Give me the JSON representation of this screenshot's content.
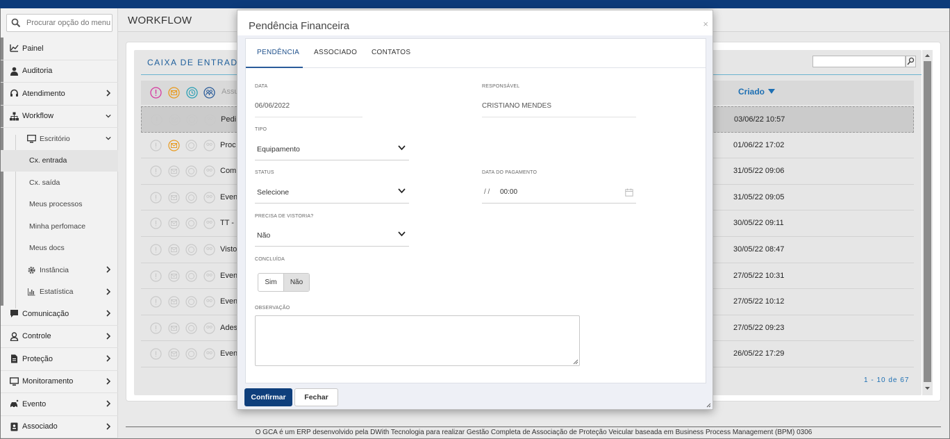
{
  "search": {
    "placeholder": "Procurar opção do menu..."
  },
  "sidebar": {
    "items": [
      {
        "label": "Painel"
      },
      {
        "label": "Auditoria"
      },
      {
        "label": "Atendimento"
      },
      {
        "label": "Workflow"
      },
      {
        "label": "Escritório"
      },
      {
        "label": "Cx. entrada"
      },
      {
        "label": "Cx. saída"
      },
      {
        "label": "Meus processos"
      },
      {
        "label": "Minha perfomace"
      },
      {
        "label": "Meus docs"
      },
      {
        "label": "Instância"
      },
      {
        "label": "Estatística"
      },
      {
        "label": "Comunicação"
      },
      {
        "label": "Controle"
      },
      {
        "label": "Proteção"
      },
      {
        "label": "Monitoramento"
      },
      {
        "label": "Evento"
      },
      {
        "label": "Associado"
      }
    ]
  },
  "header": {
    "title": "WORKFLOW"
  },
  "inbox": {
    "title": "CAIXA DE ENTRADA",
    "col_subject": "Assu",
    "col_created": "Criado",
    "rows": [
      {
        "text": "Pedi",
        "date": "03/06/22 10:57"
      },
      {
        "text": "Proc",
        "date": "01/06/22 17:02"
      },
      {
        "text": "Com",
        "date": "31/05/22 09:06"
      },
      {
        "text": "Even",
        "date": "31/05/22 09:05"
      },
      {
        "text": "TT -",
        "date": "30/05/22 09:11"
      },
      {
        "text": "Visto",
        "date": "30/05/22 08:47"
      },
      {
        "text": "Even",
        "date": "27/05/22 10:31"
      },
      {
        "text": "Even",
        "date": "27/05/22 10:12"
      },
      {
        "text": "Ades",
        "date": "27/05/22 09:23"
      },
      {
        "text": "Even",
        "date": "26/05/22 17:29"
      }
    ],
    "pager": "1 - 10 de 67"
  },
  "footer": {
    "text": "O GCA é um ERP desenvolvido pela DWith Tecnologia para realizar Gestão Completa de Associação de Proteção Veicular baseada em Business Process Management (BPM) 0306"
  },
  "modal": {
    "title": "Pendência Financeira",
    "close": "×",
    "tabs": [
      "PENDÊNCIA",
      "ASSOCIADO",
      "CONTATOS"
    ],
    "fields": {
      "data_label": "DATA",
      "data_value": "06/06/2022",
      "responsavel_label": "RESPONSÁVEL",
      "responsavel_value": "CRISTIANO MENDES",
      "tipo_label": "TIPO",
      "tipo_value": "Equipamento",
      "status_label": "STATUS",
      "status_value": "Selecione",
      "data_pagamento_label": "DATA DO PAGAMENTO",
      "data_pagamento_date": "/ /",
      "data_pagamento_time": "00:00",
      "vistoria_label": "PRECISA DE VISTORIA?",
      "vistoria_value": "Não",
      "concluida_label": "CONCLUÍDA",
      "concluida_sim": "Sim",
      "concluida_nao": "Não",
      "observacao_label": "OBSERVAÇÃO"
    },
    "buttons": {
      "confirm": "Confirmar",
      "close": "Fechar"
    }
  },
  "colors": {
    "brand": "#0d3b7a",
    "accent": "#1d6fb3",
    "pink": "#d63aa0",
    "orange": "#e89a1e",
    "teal": "#2aa0b5",
    "navy": "#2a5c9a"
  }
}
